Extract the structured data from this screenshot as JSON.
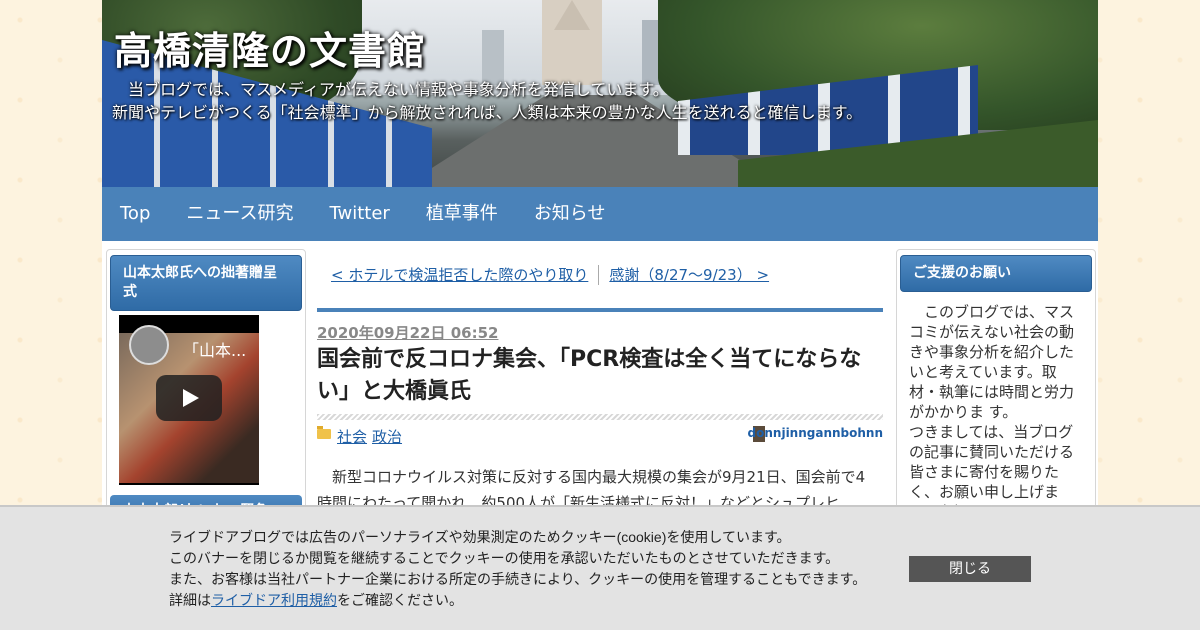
{
  "blog": {
    "title": "高橋清隆の文書館",
    "description_line1": "　当ブログでは、マスメディアが伝えない情報や事象分析を発信しています。",
    "description_line2": "新聞やテレビがつくる「社会標準」から解放されれば、人類は本来の豊かな人生を送れると確信します。"
  },
  "nav": {
    "items": [
      "Top",
      "ニュース研究",
      "Twitter",
      "植草事件",
      "お知らせ"
    ]
  },
  "left_sidebar": {
    "box1_title": "山本太郎氏への拙著贈呈式",
    "video_title": "「山本...",
    "box2_title": "山本太郎(れいわ　緊急"
  },
  "right_sidebar": {
    "title": "ご支援のお願い",
    "text": "　このブログでは、マスコミが伝えない社会の動きや事象分析を紹介したいと考えています。取材・執筆には時間と労力がかかりま す。　　　　　つきましては、当ブログの記事に賛同いただける皆さまに寄付を賜りたく、お願い申し上げます。少額でも"
  },
  "pager": {
    "prev": "< ホテルで検温拒否した際のやり取り",
    "next": "感謝（8/27～9/23） >"
  },
  "post": {
    "date": "2020年09月22日 06:52",
    "title": "国会前で反コロナ集会、「PCR検査は全く当てにならない」と大橋眞氏",
    "categories": [
      "社会",
      "政治"
    ],
    "author": "donnjinngannbohnn",
    "body": "　新型コロナウイルス対策に反対する国内最大規模の集会が9月21日、国会前で4時間にわたって開かれ、約500人が「新生活様式に反対！」などとシュプレヒ"
  },
  "cookie": {
    "line1": "ライブドアブログでは広告のパーソナライズや効果測定のためクッキー(cookie)を使用しています。",
    "line2": "このバナーを閉じるか閲覧を継続することでクッキーの使用を承認いただいたものとさせていただきます。",
    "line3": "また、お客様は当社パートナー企業における所定の手続きにより、クッキーの使用を管理することもできます。",
    "line4_prefix": "詳細は",
    "line4_link": "ライブドア利用規約",
    "line4_suffix": "をご確認ください。",
    "close_label": "閉じる"
  }
}
